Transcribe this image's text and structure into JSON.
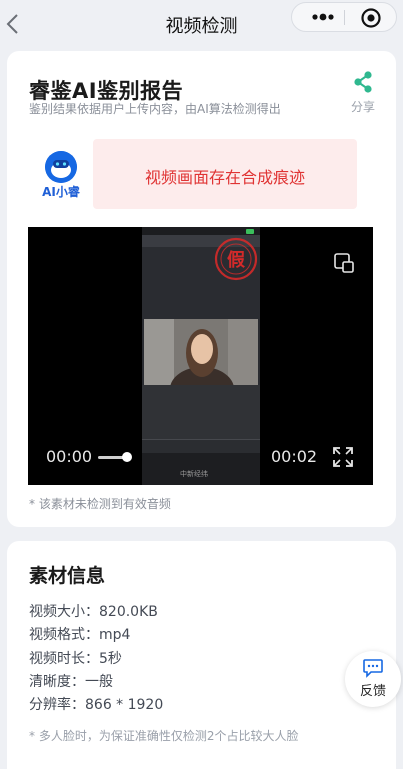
{
  "nav": {
    "title": "视频检测"
  },
  "report": {
    "title": "睿鉴AI鉴别报告",
    "subtitle": "鉴别结果依据用户上传内容，由AI算法检测得出",
    "share_label": "分享",
    "assistant_name": "AI小睿",
    "verdict": "视频画面存在合成痕迹",
    "verdict_color": "#e03434",
    "audio_note": "* 该素材未检测到有效音频"
  },
  "video": {
    "current_time": "00:00",
    "duration": "00:02",
    "progress": 0.0,
    "stamp_text": "假",
    "watermark": "中新经纬"
  },
  "info": {
    "title": "素材信息",
    "rows": [
      "视频大小：820.0KB",
      "视频格式：mp4",
      "视频时长：5秒",
      "清晰度：一般",
      "分辨率：866 * 1920"
    ],
    "note": "* 多人脸时，为保证准确性仅检测2个占比较大人脸"
  },
  "feedback": {
    "label": "反馈"
  },
  "colors": {
    "accent": "#1668e3",
    "share_green": "#2fb88f",
    "page_bg": "#eef0f4"
  },
  "icons": [
    "back-icon",
    "more-icon",
    "close-target-icon",
    "share-icon",
    "pip-icon",
    "fullscreen-icon",
    "feedback-icon"
  ]
}
